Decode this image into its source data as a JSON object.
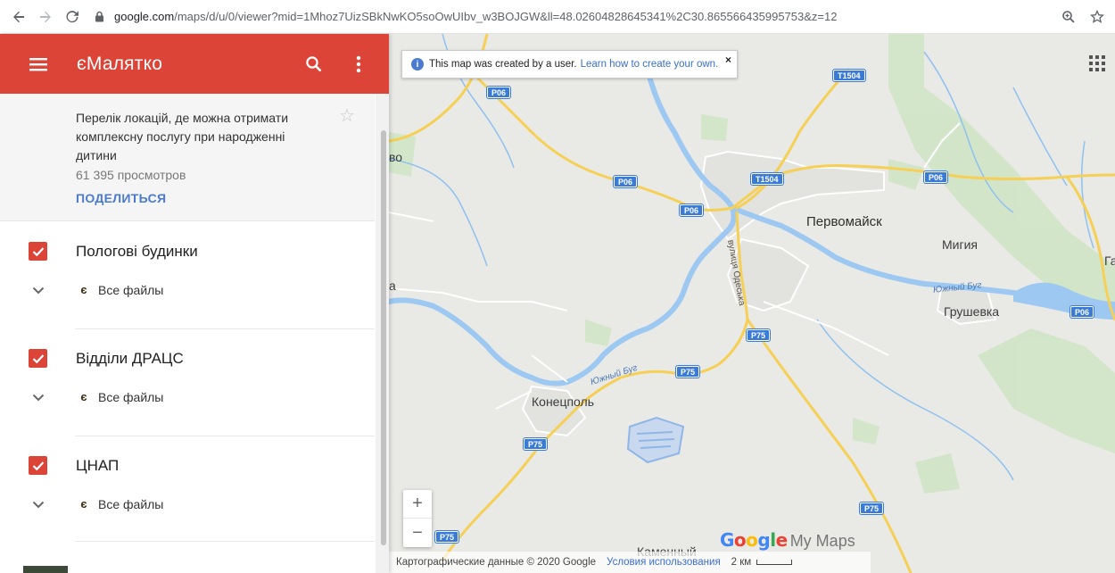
{
  "browser": {
    "url_host": "google.com",
    "url_rest": "/maps/d/u/0/viewer?mid=1Mhoz7UizSBkNwKO5soOwUIbv_w3BOJGW&ll=48.02604828645341%2C30.865566435995753&z=12"
  },
  "app": {
    "title": "єМалятко",
    "accent_color": "#db4437"
  },
  "info": {
    "description": "Перелік локацій, де можна отримати комплексну послугу при народженні дитини",
    "views": "61 395 просмотров",
    "share_label": "ПОДЕЛИТЬСЯ"
  },
  "layers": [
    {
      "name": "Пологові будинки",
      "files_label": "Все файлы",
      "checked": true
    },
    {
      "name": "Відділи ДРАЦС",
      "files_label": "Все файлы",
      "checked": true
    },
    {
      "name": "ЦНАП",
      "files_label": "Все файлы",
      "checked": true
    }
  ],
  "map": {
    "notice_text": "This map was created by a user.",
    "notice_link": "Learn how to create your own.",
    "places": {
      "pervomaisk": "Первомайск",
      "myhiia": "Мигия",
      "grushevka": "Грушевка",
      "konetspol": "Конецполь",
      "kamennyi": "Каменный",
      "vo_edge": "во",
      "a_edge": "а",
      "ga_edge": "Га"
    },
    "roads": {
      "p06": "P06",
      "t1504": "T1504",
      "p75": "P75"
    },
    "rivers": {
      "yuzhnyi_bug": "Южный Буг"
    },
    "street": "вулиця Одеська",
    "zoom_in": "+",
    "zoom_out": "−",
    "logo_google": "Google",
    "logo_mymaps": "My Maps",
    "attribution": "Картографические данные © 2020 Google",
    "terms": "Условия использования",
    "scale": "2 км"
  }
}
